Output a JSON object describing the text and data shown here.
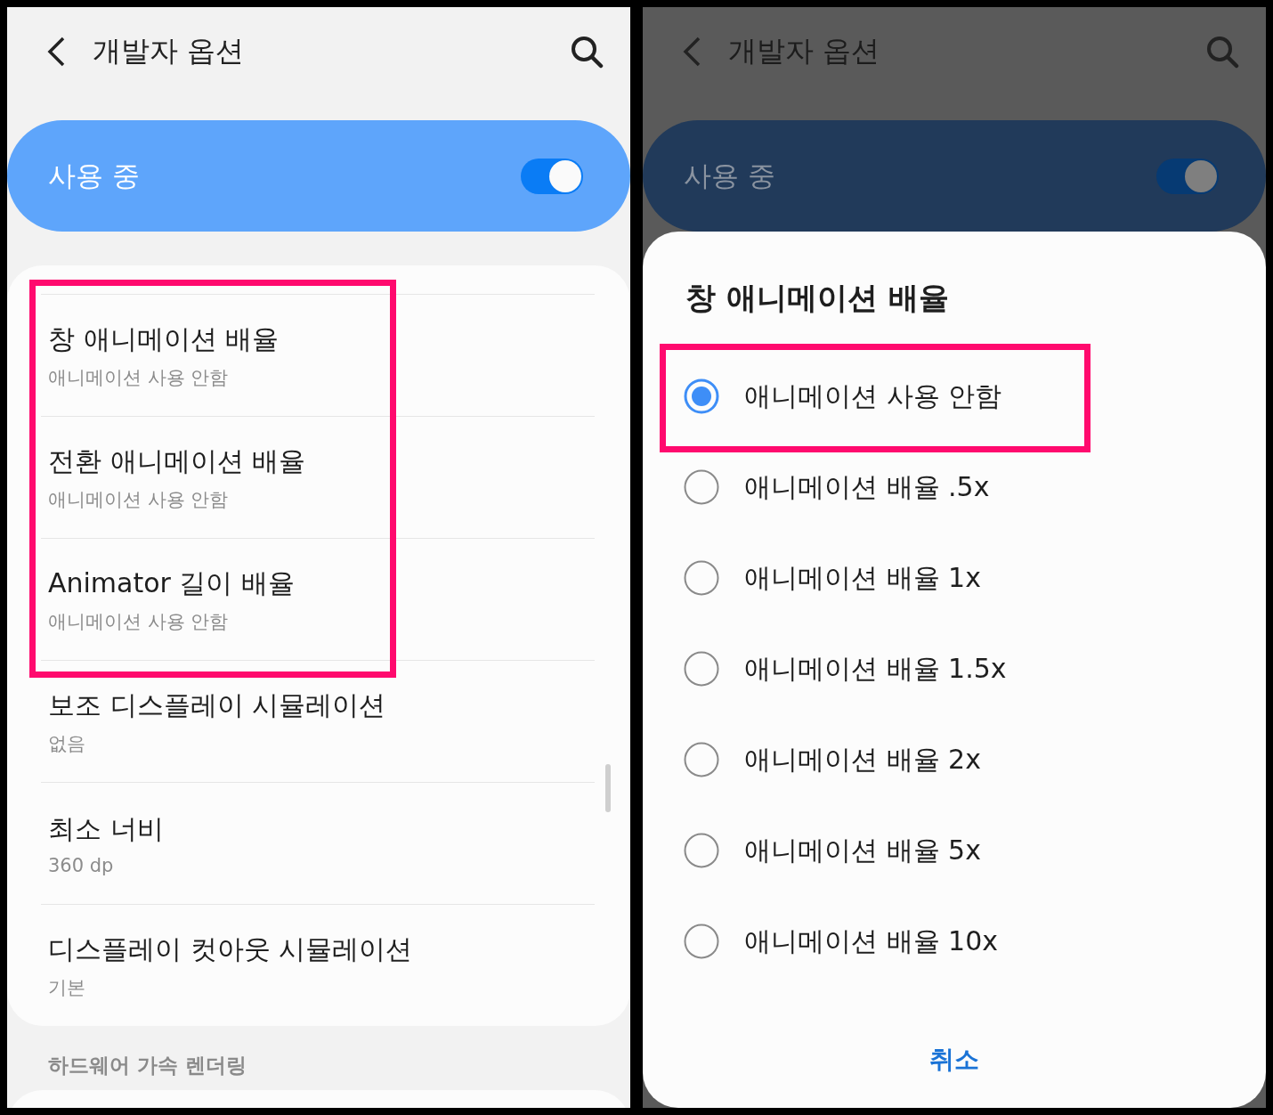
{
  "settings_screen": {
    "title": "개발자 옵션",
    "dimmed": false,
    "master_switch": {
      "label": "사용 중",
      "on": true
    },
    "items": [
      {
        "title": "창 애니메이션 배율",
        "value": "애니메이션 사용 안함",
        "highlighted": true
      },
      {
        "title": "전환 애니메이션 배율",
        "value": "애니메이션 사용 안함",
        "highlighted": true
      },
      {
        "title": "Animator 길이 배율",
        "value": "애니메이션 사용 안함",
        "highlighted": true
      },
      {
        "title": "보조 디스플레이 시뮬레이션",
        "value": "없음",
        "highlighted": false
      },
      {
        "title": "최소 너비",
        "value": "360 dp",
        "highlighted": false
      },
      {
        "title": "디스플레이 컷아웃 시뮬레이션",
        "value": "기본",
        "highlighted": false
      }
    ],
    "section_header": "하드웨어 가속 렌더링"
  },
  "dialog_screen": {
    "title": "개발자 옵션",
    "dimmed": true,
    "master_switch": {
      "label": "사용 중",
      "on": true
    },
    "dialog": {
      "title": "창 애니메이션 배율",
      "options": [
        {
          "label": "애니메이션 사용 안함",
          "selected": true,
          "highlighted": true
        },
        {
          "label": "애니메이션 배율 .5x",
          "selected": false,
          "highlighted": false
        },
        {
          "label": "애니메이션 배율 1x",
          "selected": false,
          "highlighted": false
        },
        {
          "label": "애니메이션 배율 1.5x",
          "selected": false,
          "highlighted": false
        },
        {
          "label": "애니메이션 배율 2x",
          "selected": false,
          "highlighted": false
        },
        {
          "label": "애니메이션 배율 5x",
          "selected": false,
          "highlighted": false
        },
        {
          "label": "애니메이션 배율 10x",
          "selected": false,
          "highlighted": false
        }
      ],
      "cancel": "취소"
    }
  }
}
